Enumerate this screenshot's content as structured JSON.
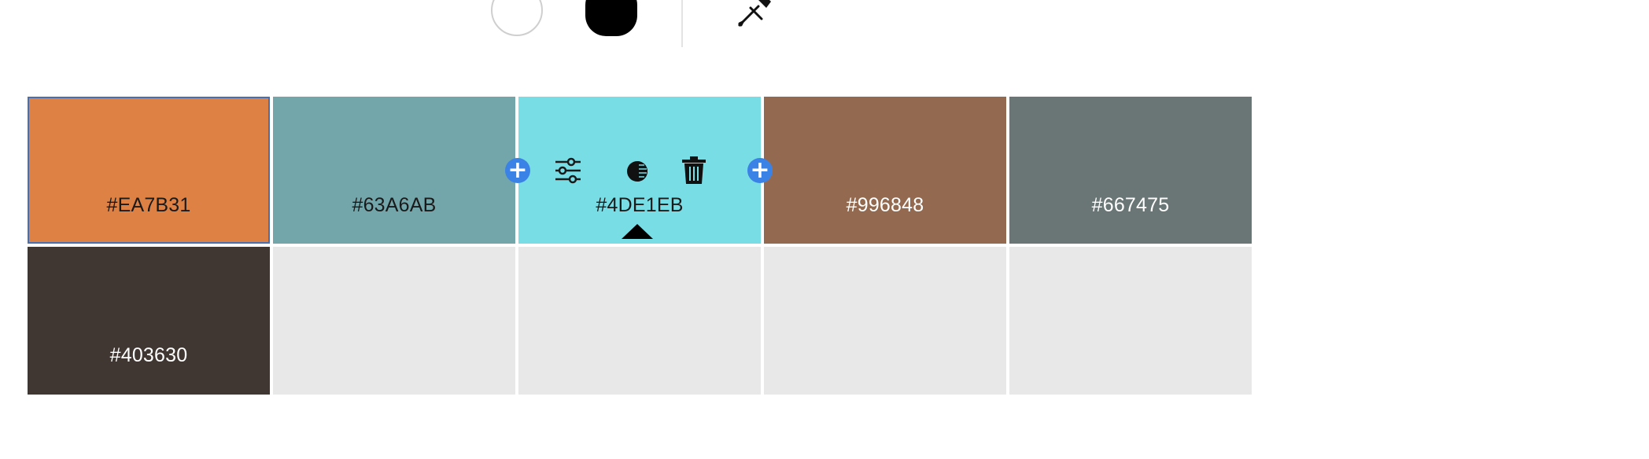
{
  "toolbar": {
    "white_swatch": {
      "icon": "circle-white-swatch",
      "color": "#FFFFFF"
    },
    "black_swatch": {
      "icon": "circle-black-swatch",
      "color": "#000000"
    },
    "eyedropper": {
      "icon": "eyedropper-icon"
    }
  },
  "palette": {
    "swatches": [
      {
        "hex": "#EA7B31",
        "fill": "#DD8145",
        "text_tone": "dark",
        "selected": true
      },
      {
        "hex": "#63A6AB",
        "fill": "#73A6AA",
        "text_tone": "dark"
      },
      {
        "hex": "#4DE1EB",
        "fill": "#79DDE6",
        "text_tone": "dark",
        "active": true
      },
      {
        "hex": "#996848",
        "fill": "#936A4F",
        "text_tone": "light"
      },
      {
        "hex": "#667475",
        "fill": "#697675",
        "text_tone": "light"
      },
      {
        "hex": "#403630",
        "fill": "#403632",
        "text_tone": "light"
      },
      {
        "hex": "",
        "fill": "#E8E8E8"
      },
      {
        "hex": "",
        "fill": "#E8E8E8"
      },
      {
        "hex": "",
        "fill": "#E8E8E8"
      },
      {
        "hex": "",
        "fill": "#E8E8E8"
      }
    ],
    "active_tools": {
      "add_before": "add-color-before-icon",
      "adjust": "sliders-icon",
      "contrast": "contrast-icon",
      "delete": "trash-icon",
      "add_after": "add-color-after-icon"
    }
  },
  "colors": {
    "accent": "#3B82E6",
    "selection_outline": "#4A6FB0",
    "empty_cell": "#E8E8E8"
  }
}
